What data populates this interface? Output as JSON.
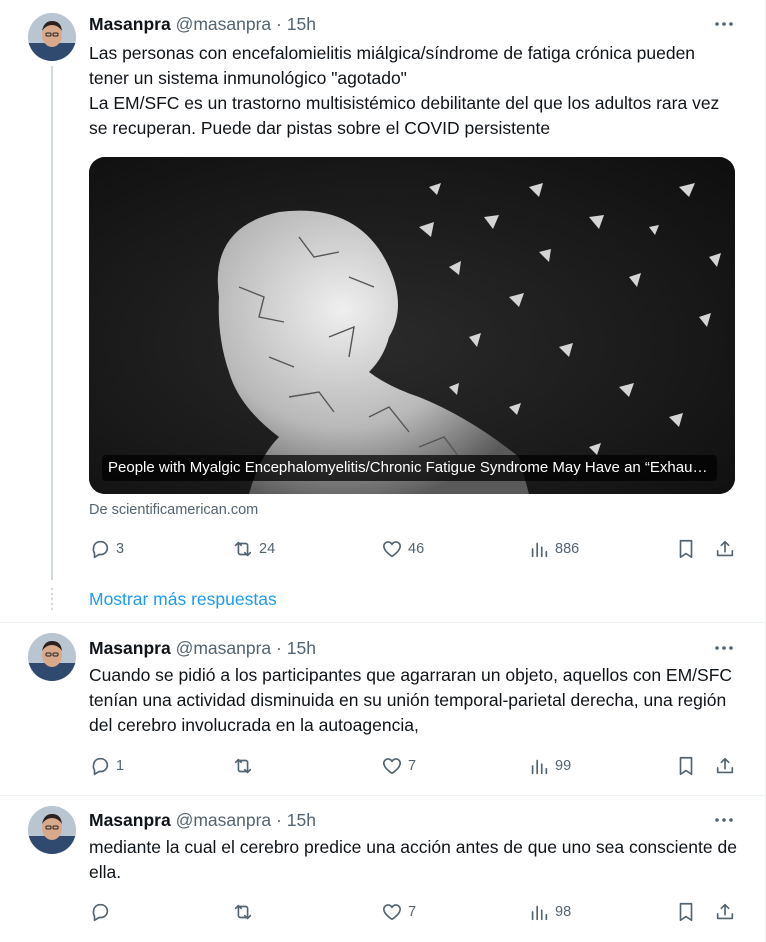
{
  "tweet1": {
    "name": "Masanpra",
    "handle": "@masanpra",
    "time": "15h",
    "text_lines": [
      "Las personas con encefalomielitis miálgica/síndrome de fatiga crónica pueden tener un sistema inmunológico \"agotado\"",
      "La EM/SFC es un trastorno multisistémico debilitante del que los adultos rara vez se recuperan. Puede dar pistas sobre el COVID persistente"
    ],
    "card_caption": "People with Myalgic Encephalomyelitis/Chronic Fatigue Syndrome May Have an “Exhausted” Immune System",
    "card_source": "De scientificamerican.com",
    "replies": "3",
    "retweets": "24",
    "likes": "46",
    "views": "886"
  },
  "show_more": "Mostrar más respuestas",
  "tweet2": {
    "name": "Masanpra",
    "handle": "@masanpra",
    "time": "15h",
    "text": "Cuando se pidió a los participantes que agarraran un objeto, aquellos con EM/SFC tenían una actividad disminuida en su unión temporal-parietal derecha, una región del cerebro involucrada en la autoagencia,",
    "replies": "1",
    "retweets": "",
    "likes": "7",
    "views": "99"
  },
  "tweet3": {
    "name": "Masanpra",
    "handle": "@masanpra",
    "time": "15h",
    "text": "mediante la cual el cerebro predice una acción antes de que uno sea consciente de ella.",
    "replies": "",
    "retweets": "",
    "likes": "7",
    "views": "98"
  },
  "colors": {
    "text": "#0f1419",
    "secondary": "#536471",
    "link": "#1d9bf0",
    "border": "#eff3f4"
  },
  "icons": [
    "more-icon",
    "reply-icon",
    "retweet-icon",
    "like-icon",
    "views-icon",
    "bookmark-icon",
    "share-icon"
  ]
}
